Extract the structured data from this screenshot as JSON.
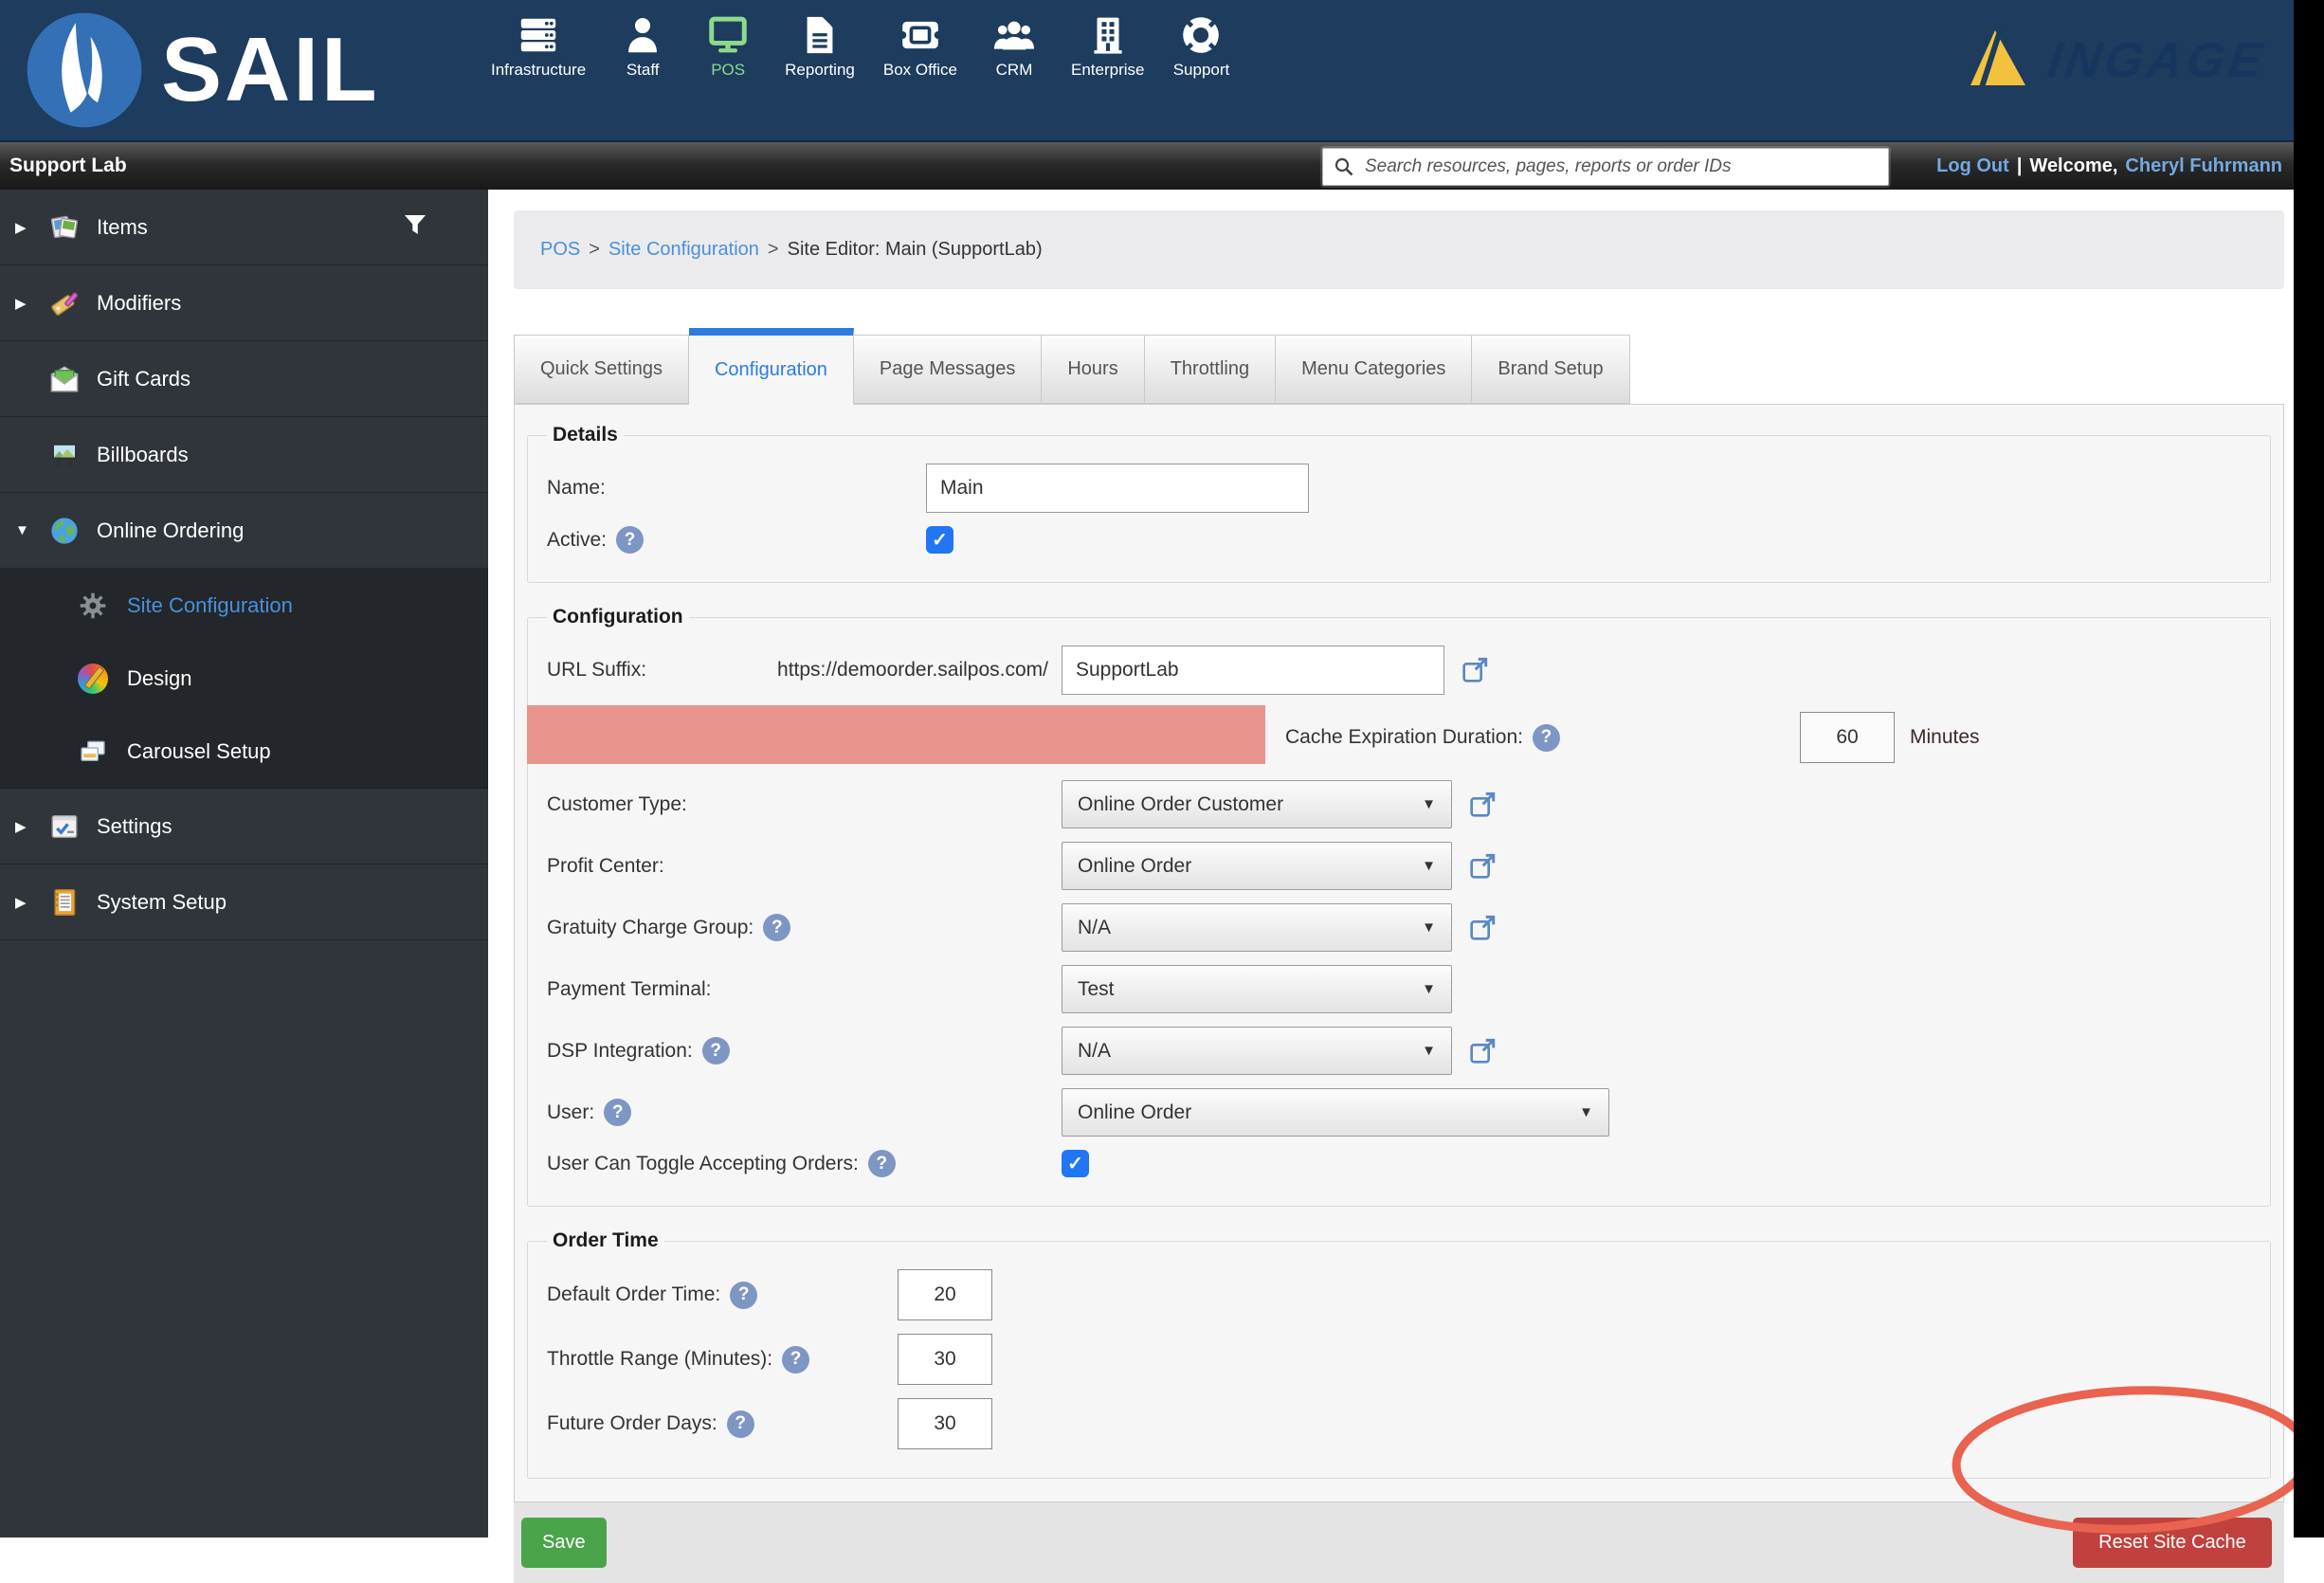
{
  "colors": {
    "topbar_navy": "#1d3c5e",
    "pos_green": "#8ed98b",
    "sidebar_bg": "#30353b",
    "link_blue": "#4a90d9",
    "tab_active_blue": "#2b7de1",
    "highlight_salmon": "#e9948c",
    "annotation_red": "#e96350",
    "save_green": "#4aa44a",
    "reset_red": "#c0413d",
    "ingage_yellow": "#f2c23e"
  },
  "brand": {
    "sail": "SAIL",
    "ingage": "INGAGE"
  },
  "topnav": {
    "items": [
      {
        "label": "Infrastructure",
        "icon": "servers-icon"
      },
      {
        "label": "Staff",
        "icon": "person-icon"
      },
      {
        "label": "POS",
        "icon": "monitor-icon",
        "active": true
      },
      {
        "label": "Reporting",
        "icon": "document-icon"
      },
      {
        "label": "Box Office",
        "icon": "ticket-icon"
      },
      {
        "label": "CRM",
        "icon": "people-group-icon"
      },
      {
        "label": "Enterprise",
        "icon": "building-icon"
      },
      {
        "label": "Support",
        "icon": "life-ring-icon"
      }
    ]
  },
  "statusbar": {
    "site_name": "Support Lab",
    "search_placeholder": "Search resources, pages, reports or order IDs",
    "logout_label": "Log Out",
    "divider": "|",
    "welcome_label": "Welcome,",
    "user_name": "Cheryl Fuhrmann"
  },
  "sidebar": {
    "items": [
      {
        "label": "Items",
        "expandable": true,
        "filter": true
      },
      {
        "label": "Modifiers",
        "expandable": true
      },
      {
        "label": "Gift Cards"
      },
      {
        "label": "Billboards"
      },
      {
        "label": "Online Ordering",
        "expanded": true,
        "children": [
          {
            "label": "Site Configuration",
            "selected": true
          },
          {
            "label": "Design"
          },
          {
            "label": "Carousel Setup"
          }
        ]
      },
      {
        "label": "Settings",
        "expandable": true
      },
      {
        "label": "System Setup",
        "expandable": true
      }
    ],
    "expand_arrow": "▶",
    "collapse_arrow": "▼"
  },
  "breadcrumb": {
    "separator": ">",
    "items": [
      {
        "label": "POS",
        "link": true
      },
      {
        "label": "Site Configuration",
        "link": true
      },
      {
        "label": "Site Editor: Main (SupportLab)",
        "link": false
      }
    ]
  },
  "tabs": {
    "active": "Configuration",
    "items": [
      "Quick Settings",
      "Configuration",
      "Page Messages",
      "Hours",
      "Throttling",
      "Menu Categories",
      "Brand Setup"
    ]
  },
  "form": {
    "details": {
      "legend": "Details",
      "name_label": "Name:",
      "name_value": "Main",
      "active_label": "Active:",
      "active_checked": "✓"
    },
    "configuration": {
      "legend": "Configuration",
      "url_label": "URL Suffix:",
      "url_base": "https://demoorder.sailpos.com/",
      "url_value": "SupportLab",
      "cache_label": "Cache Expiration Duration:",
      "cache_value": "60",
      "cache_unit": "Minutes",
      "selects": [
        {
          "label": "Customer Type:",
          "value": "Online Order Customer"
        },
        {
          "label": "Profit Center:",
          "value": "Online Order"
        },
        {
          "label": "Gratuity Charge Group:",
          "value": "N/A",
          "help": true
        },
        {
          "label": "Payment Terminal:",
          "value": "Test"
        },
        {
          "label": "DSP Integration:",
          "value": "N/A",
          "help": true
        },
        {
          "label": "User:",
          "value": "Online Order",
          "help": true
        }
      ],
      "toggle_label": "User Can Toggle Accepting Orders:",
      "toggle_checked": "✓"
    },
    "order_time": {
      "legend": "Order Time",
      "rows": [
        {
          "label": "Default Order Time:",
          "value": "20"
        },
        {
          "label": "Throttle Range (Minutes):",
          "value": "30"
        },
        {
          "label": "Future Order Days:",
          "value": "30"
        }
      ]
    },
    "actions": {
      "save": "Save",
      "reset": "Reset Site Cache"
    }
  }
}
